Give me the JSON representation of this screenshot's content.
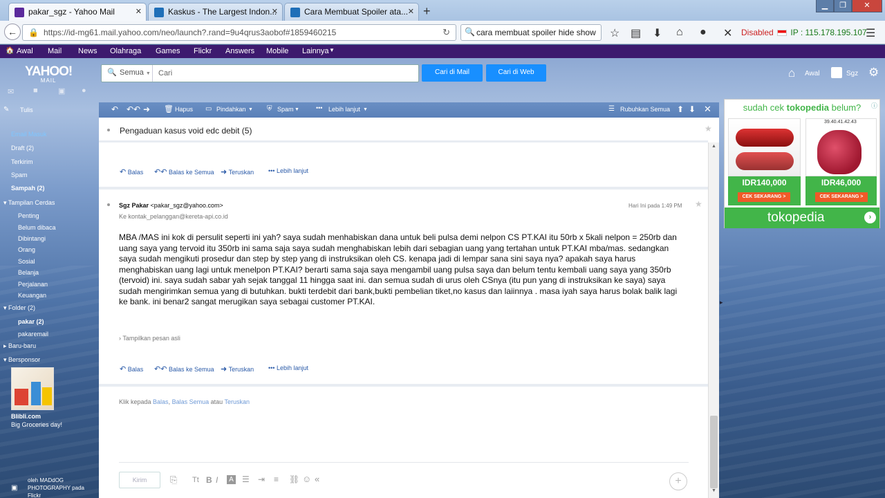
{
  "browser": {
    "tabs": [
      {
        "title": "pakar_sgz - Yahoo Mail"
      },
      {
        "title": "Kaskus - The Largest Indon..."
      },
      {
        "title": "Cara Membuat Spoiler ata..."
      }
    ],
    "url": "https://id-mg61.mail.yahoo.com/neo/launch?.rand=9u4qrus3aobof#1859460215",
    "search_text": "cara membuat spoiler hide show",
    "proxy_status": "Disabled",
    "ip_label": "IP : 115.178.195.107"
  },
  "yahoo_nav": [
    "Awal",
    "Mail",
    "News",
    "Olahraga",
    "Games",
    "Flickr",
    "Answers",
    "Mobile",
    "Lainnya"
  ],
  "header": {
    "logo": "YAHOO!",
    "logo_sub": "MAIL",
    "search_scope": "Semua",
    "search_placeholder": "Cari",
    "btn_mail": "Cari di Mail",
    "btn_web": "Cari di Web",
    "home_label": "Awal",
    "user_label": "Sgz"
  },
  "sidebar": {
    "compose": "Tulis",
    "inbox": "Email Masuk",
    "drafts": "Draft (2)",
    "sent": "Terkirim",
    "spam": "Spam",
    "trash": "Sampah (2)",
    "smart_views": "Tampilan Cerdas",
    "smart_items": [
      "Penting",
      "Belum dibaca",
      "Dibintangi",
      "Orang",
      "Sosial",
      "Belanja",
      "Perjalanan",
      "Keuangan"
    ],
    "folders": "Folder (2)",
    "folder_items": [
      "pakar (2)",
      "pakaremail"
    ],
    "recent": "Baru-baru",
    "sponsor": "Bersponsor",
    "sponsor_name": "Blibli.com",
    "sponsor_text": "Big Groceries day!",
    "photo_credit": "oleh MADdOG PHOTOGRAPHY pada Flickr"
  },
  "toolbar": {
    "delete": "Hapus",
    "move": "Pindahkan",
    "spam": "Spam",
    "more": "Lebih lanjut",
    "collapse": "Rubuhkan Semua"
  },
  "email": {
    "subject": "Pengaduan kasus void edc debit (5)",
    "reply": "Balas",
    "reply_all": "Balas ke Semua",
    "forward": "Teruskan",
    "more": "Lebih lanjut",
    "sender_name": "Sgz Pakar",
    "sender_email": "<pakar_sgz@yahoo.com>",
    "to": "Ke kontak_pelanggan@kereta-api.co.id",
    "time": "Hari Ini pada 1:49 PM",
    "body": "MBA /MAS ini kok di persulit seperti ini yah? saya sudah menhabiskan dana untuk beli pulsa demi nelpon CS PT.KAI itu 50rb x 5kali nelpon = 250rb dan uang saya yang tervoid itu 350rb ini sama saja saya sudah menghabiskan lebih dari sebagian uang yang tertahan untuk PT.KAI mba/mas. sedangkan saya sudah mengikuti prosedur dan step by step yang di instruksikan oleh CS. kenapa jadi di lempar sana sini saya nya? apakah saya harus menghabiskan uang lagi untuk menelpon PT.KAI? berarti sama saja saya mengambil uang pulsa saya dan belum tentu kembali uang saya yang 350rb (tervoid) ini. saya sudah sabar yah sejak tanggal 11 hingga saat ini. dan semua sudah di urus oleh CSnya (itu pun yang di instruksikan ke saya) saya sudah mengirimkan semua yang di butuhkan. bukti terdebit dari bank,bukti pembelian tiket,no kasus dan laiinnya . masa iyah saya harus bolak balik lagi ke bank. ini benar2 sangat merugikan saya sebagai customer PT.KAI.",
    "show_original": "Tampilkan pesan asli",
    "quick_reply_prefix": "Klik kepada",
    "quick_reply_balas": "Balas",
    "quick_reply_all": "Balas Semua",
    "quick_reply_or": "atau",
    "quick_reply_fwd": "Teruskan",
    "send": "Kirim"
  },
  "ad": {
    "headline_pre": "sudah cek",
    "headline_brand": "tokopedia",
    "headline_post": "belum?",
    "price1": "IDR140,000",
    "price2": "IDR46,000",
    "cta": "CEK SEKARANG >",
    "brand": "tokopedia",
    "img_caption": "39.40.41.42.43"
  },
  "colors": {
    "yahoo_purple": "#3d1a6e",
    "accent_blue": "#188fff",
    "tokopedia_green": "#42b549",
    "cta_orange": "#f05a28"
  }
}
